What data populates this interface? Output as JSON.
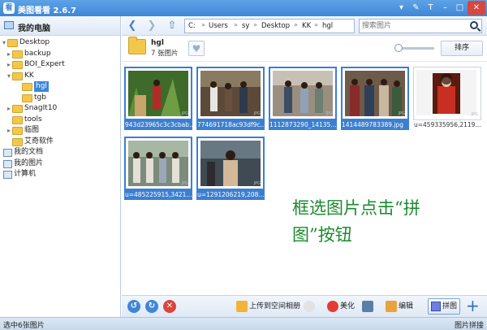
{
  "window": {
    "title": "美图看看 2.6.7",
    "logo_text": "看",
    "buttons": [
      "▾",
      "✎",
      "T",
      "–",
      "□",
      "✕"
    ]
  },
  "sidebar": {
    "header": "我的电脑",
    "tree": [
      {
        "label": "Desktop",
        "arrow": "▾"
      },
      {
        "label": "backup",
        "arrow": "▸"
      },
      {
        "label": "BOI_Expert",
        "arrow": "▸"
      },
      {
        "label": "KK",
        "arrow": "▾"
      },
      {
        "label": "hgl",
        "arrow": ""
      },
      {
        "label": "tgb",
        "arrow": ""
      },
      {
        "label": "SnagIt10",
        "arrow": "▸"
      },
      {
        "label": "tools",
        "arrow": ""
      },
      {
        "label": "临图",
        "arrow": "▸"
      },
      {
        "label": "艾奇软件",
        "arrow": ""
      },
      {
        "label": "我的文档",
        "arrow": ""
      },
      {
        "label": "我的图片",
        "arrow": ""
      },
      {
        "label": "计算机",
        "arrow": ""
      }
    ]
  },
  "toolbar": {
    "back": "❮",
    "forward": "❯",
    "up": "⇧",
    "path": [
      "C:",
      "Users",
      "sy",
      "Desktop",
      "KK",
      "hgl"
    ],
    "separator": "»",
    "search_placeholder": "搜索图片"
  },
  "folder": {
    "name": "hgl",
    "count": "7 张图片",
    "heart": "♥",
    "sort_label": "排序"
  },
  "thumbnails": [
    {
      "caption": "943d23965c3c3cbab...",
      "selected": true
    },
    {
      "caption": "774691718ac93df9c...",
      "selected": true
    },
    {
      "caption": "1112873290_14135...",
      "selected": true
    },
    {
      "caption": "1414489783389.jpg",
      "selected": true
    },
    {
      "caption": "u=459335956,2119...",
      "selected": false
    },
    {
      "caption": "u=485225915,3421...",
      "selected": true
    },
    {
      "caption": "u=1291206219,208...",
      "selected": true
    }
  ],
  "jpg_tag": "JPG",
  "overlay_text": {
    "line1": "框选图片点击“拼",
    "line2": "图”按钮"
  },
  "bottom": {
    "upload": "上传到空间相册",
    "beautify": "美化",
    "edit": "编辑",
    "pin": "拼图",
    "plus": "+",
    "rotate_left": "↺",
    "rotate_right": "↻",
    "delete": "✕"
  },
  "status": {
    "left": "选中6张图片",
    "right": "图片拼接"
  }
}
